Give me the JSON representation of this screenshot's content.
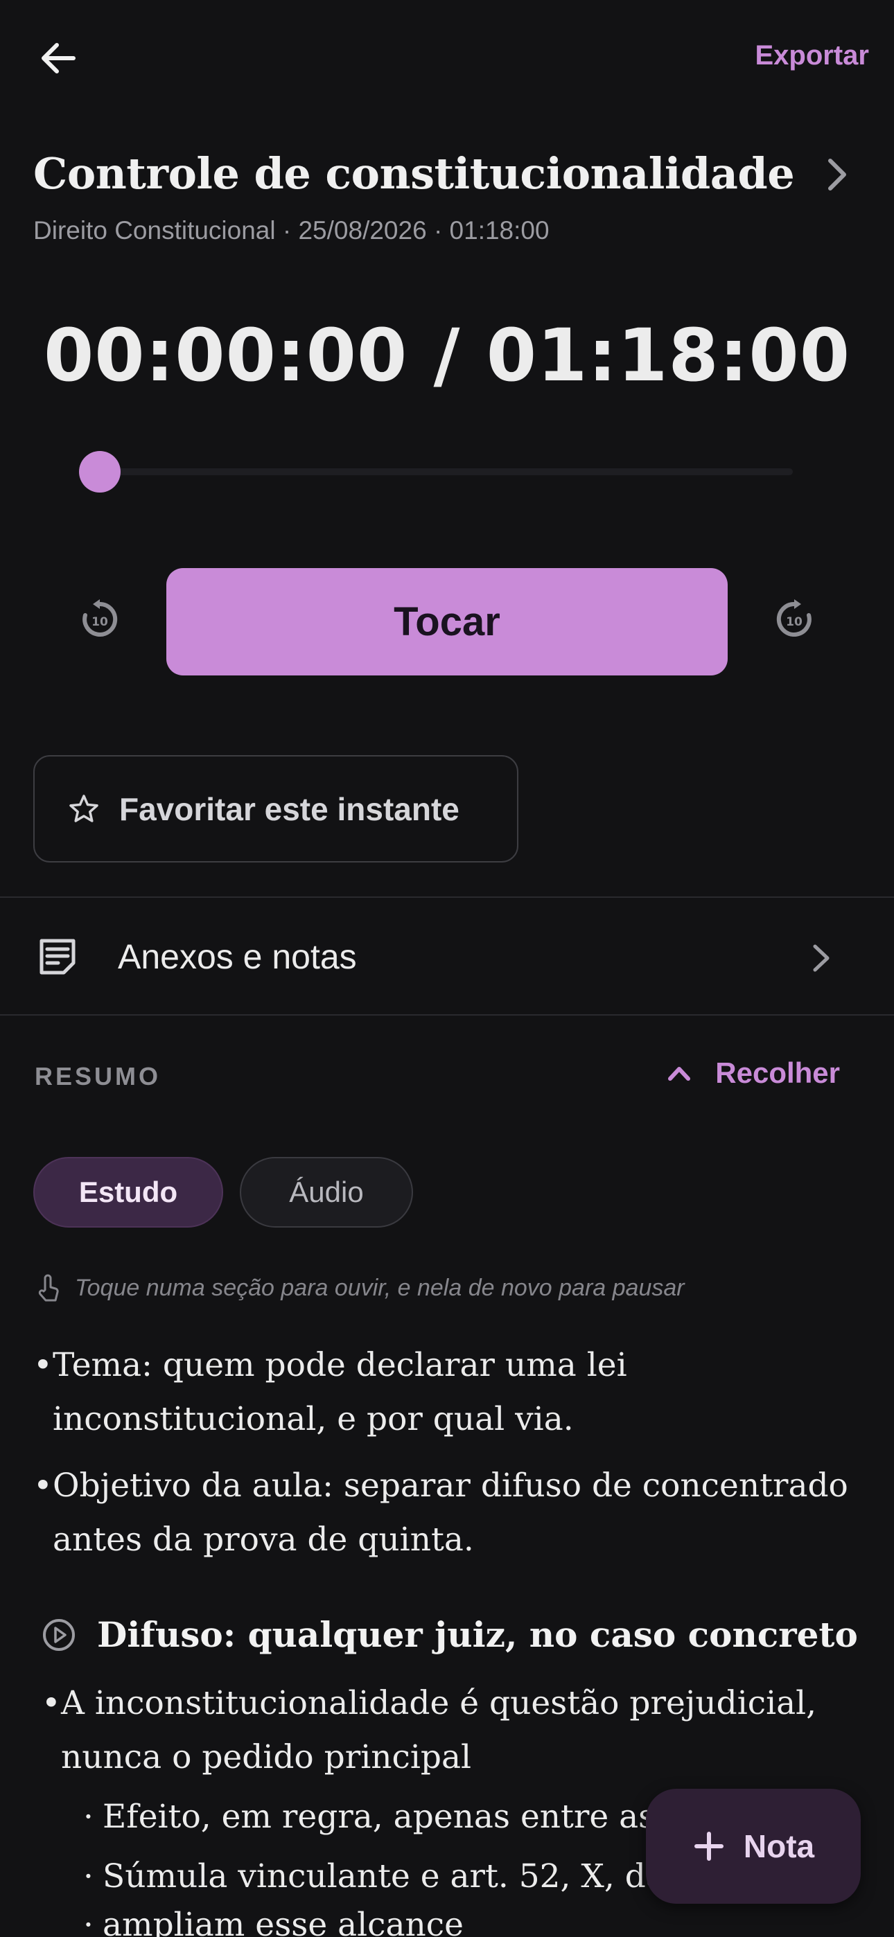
{
  "header": {
    "back_icon": "arrow-left-icon",
    "export_label": "Exportar"
  },
  "recording": {
    "title": "Controle de constitucionalidade",
    "subtitle": "Direito Constitucional · 25/08/2026 · 01:18:00"
  },
  "player": {
    "time_display": "00:00:00 / 01:18:00",
    "progress_fraction": 0,
    "play_label": "Tocar",
    "skip_back_icon": "replay-10-icon",
    "skip_forward_icon": "forward-10-icon",
    "accent_color": "#c98bd8"
  },
  "favorite": {
    "icon": "star-outline-icon",
    "label": "Favoritar este instante"
  },
  "attachments": {
    "icon": "notes-icon",
    "label": "Anexos e notas"
  },
  "summary": {
    "section_label": "RESUMO",
    "collapse_label": "Recolher",
    "tabs": [
      {
        "label": "Estudo",
        "selected": true
      },
      {
        "label": "Áudio",
        "selected": false
      }
    ],
    "hint": "Toque numa seção para ouvir, e nela de novo para pausar",
    "intro_bullets": [
      "Tema: quem pode declarar uma lei inconstitucional, e por qual via.",
      "Objetivo da aula: separar difuso de concentrado antes da prova de quinta."
    ],
    "section_heading": "Difuso: qualquer juiz, no caso concreto",
    "section_bullet": "A inconstitucionalidade é questão prejudicial, nunca o pedido principal",
    "section_sub_bullets": [
      "Efeito, em regra, apenas entre as",
      "Súmula vinculante e art. 52, X, da",
      "ampliam esse alcance"
    ]
  },
  "fab": {
    "icon": "plus-icon",
    "label": "Nota"
  }
}
